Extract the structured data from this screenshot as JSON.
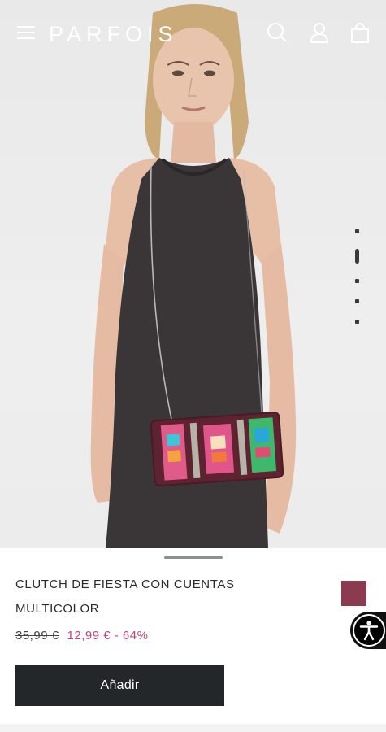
{
  "header": {
    "brand": "PARFOIS",
    "menu_icon": "hamburger-menu-icon",
    "search_icon": "search-icon",
    "account_icon": "user-icon",
    "cart_icon": "shopping-bag-icon"
  },
  "gallery": {
    "image_count": 5,
    "active_index": 1
  },
  "product": {
    "title": "CLUTCH DE FIESTA CON CUENTAS MULTICOLOR",
    "old_price": "35,99 €",
    "new_price": "12,99 € - 64%",
    "selected_color": "#8b3a50",
    "add_button_label": "Añadir"
  },
  "colors": {
    "sale_price": "#c2467a",
    "button_bg": "#24272a",
    "swatch": "#8b3a50"
  },
  "accessibility": {
    "icon": "accessibility-icon"
  }
}
